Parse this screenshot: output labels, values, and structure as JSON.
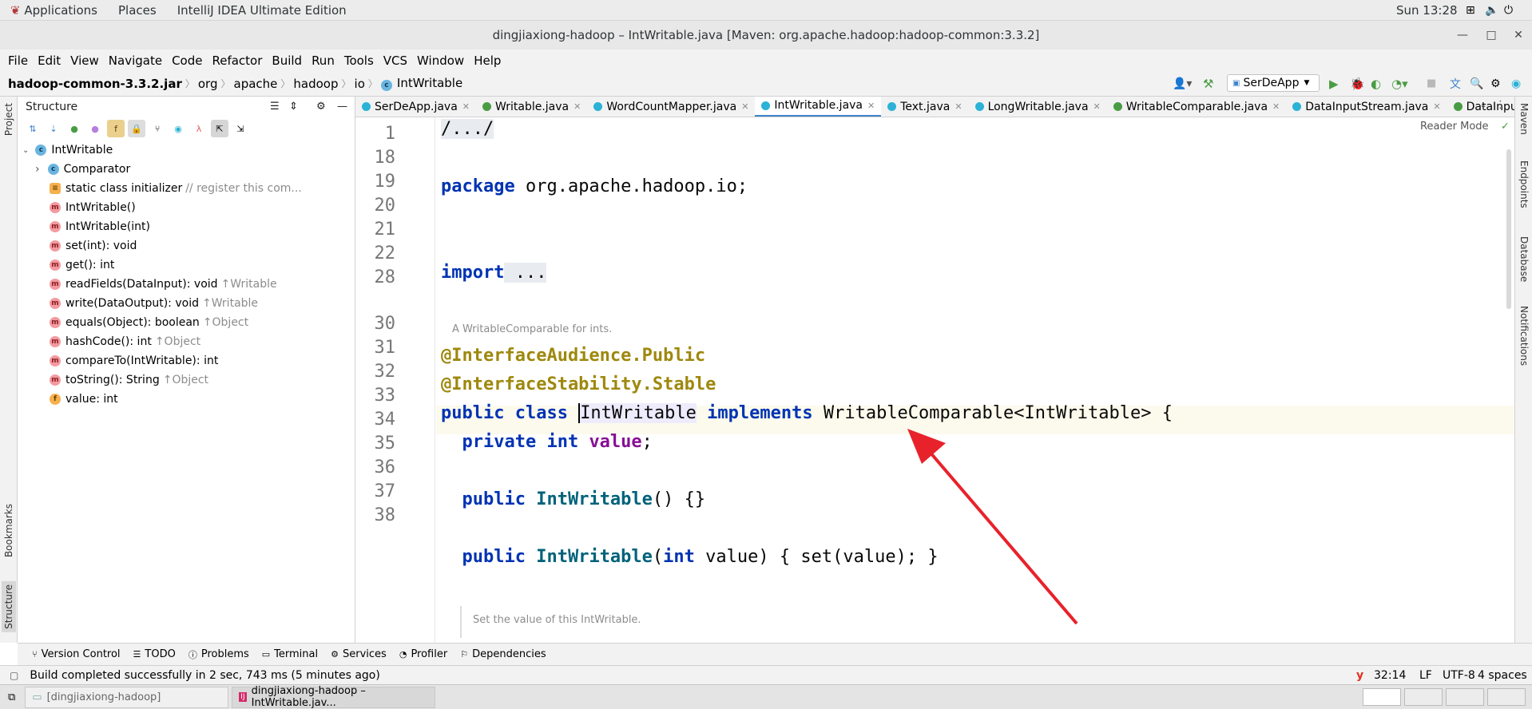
{
  "gnome": {
    "applications": "Applications",
    "places": "Places",
    "app": "IntelliJ IDEA Ultimate Edition",
    "clock": "Sun 13:28"
  },
  "window": {
    "title": "dingjiaxiong-hadoop – IntWritable.java [Maven: org.apache.hadoop:hadoop-common:3.3.2]"
  },
  "menu": [
    "File",
    "Edit",
    "View",
    "Navigate",
    "Code",
    "Refactor",
    "Build",
    "Run",
    "Tools",
    "VCS",
    "Window",
    "Help"
  ],
  "breadcrumb": [
    "hadoop-common-3.3.2.jar",
    "org",
    "apache",
    "hadoop",
    "io",
    "IntWritable"
  ],
  "run_config": "SerDeApp",
  "left_strip": {
    "project": "Project",
    "bookmarks": "Bookmarks",
    "structure": "Structure"
  },
  "right_strip": {
    "maven": "Maven",
    "endpoints": "Endpoints",
    "database": "Database",
    "notifications": "Notifications"
  },
  "structure": {
    "title": "Structure",
    "root": "IntWritable",
    "items": [
      {
        "icon": "c",
        "label": "Comparator",
        "hint": ""
      },
      {
        "icon": "s",
        "label": "static class initializer",
        "hint": "// register this com..."
      },
      {
        "icon": "m",
        "label": "IntWritable()",
        "hint": ""
      },
      {
        "icon": "m",
        "label": "IntWritable(int)",
        "hint": ""
      },
      {
        "icon": "m",
        "label": "set(int): void",
        "hint": ""
      },
      {
        "icon": "m",
        "label": "get(): int",
        "hint": ""
      },
      {
        "icon": "m",
        "label": "readFields(DataInput): void",
        "hint": "↑Writable"
      },
      {
        "icon": "m",
        "label": "write(DataOutput): void",
        "hint": "↑Writable"
      },
      {
        "icon": "m",
        "label": "equals(Object): boolean",
        "hint": "↑Object"
      },
      {
        "icon": "m",
        "label": "hashCode(): int",
        "hint": "↑Object"
      },
      {
        "icon": "m",
        "label": "compareTo(IntWritable): int",
        "hint": ""
      },
      {
        "icon": "m",
        "label": "toString(): String",
        "hint": "↑Object"
      },
      {
        "icon": "f",
        "label": "value: int",
        "hint": ""
      }
    ]
  },
  "tabs": [
    {
      "label": "SerDeApp.java",
      "kind": "c",
      "active": false
    },
    {
      "label": "Writable.java",
      "kind": "i",
      "active": false
    },
    {
      "label": "WordCountMapper.java",
      "kind": "c",
      "active": false
    },
    {
      "label": "IntWritable.java",
      "kind": "c",
      "active": true
    },
    {
      "label": "Text.java",
      "kind": "c",
      "active": false
    },
    {
      "label": "LongWritable.java",
      "kind": "c",
      "active": false
    },
    {
      "label": "WritableComparable.java",
      "kind": "i",
      "active": false
    },
    {
      "label": "DataInputStream.java",
      "kind": "c",
      "active": false
    },
    {
      "label": "DataInput.ja",
      "kind": "i",
      "active": false
    }
  ],
  "editor": {
    "reader_mode": "Reader Mode",
    "line_numbers": [
      "1",
      "18",
      "19",
      "20",
      "21",
      "22",
      "28",
      "30",
      "31",
      "32",
      "33",
      "34",
      "35",
      "36",
      "37",
      "38"
    ],
    "doc1": "A WritableComparable for ints.",
    "doc2": "Set the value of this IntWritable.",
    "fold1": "/.../",
    "pkg_kw": "package",
    "pkg_name": " org.apache.hadoop.io;",
    "import_kw": "import",
    "import_dots": " ...",
    "ann1": "@InterfaceAudience",
    "ann1b": ".Public",
    "ann2": "@InterfaceStability",
    "ann2b": ".Stable",
    "l32a": "public class ",
    "l32b": "IntWritable",
    "l32c": " implements ",
    "l32d": "WritableComparable<IntWritable> {",
    "l33a": "  private int ",
    "l33b": "value",
    ";": ";",
    "l35a": "  public ",
    "l35b": "IntWritable",
    "l35c": "() {}",
    "l37a": "  public ",
    "l37b": "IntWritable",
    "l37c": "(",
    "l37d": "int",
    " l37e": "",
    "l37f": " value) { set(value); }"
  },
  "bottom_tools": [
    "Version Control",
    "TODO",
    "Problems",
    "Terminal",
    "Services",
    "Profiler",
    "Dependencies"
  ],
  "status": {
    "message": "Build completed successfully in 2 sec, 743 ms (5 minutes ago)",
    "position": "32:14",
    "line_sep": "LF",
    "encoding": "UTF-8",
    "indent": "4 spaces"
  },
  "taskbar": [
    {
      "label": "[dingjiaxiong-hadoop]"
    },
    {
      "label": "dingjiaxiong-hadoop – IntWritable.jav..."
    }
  ],
  "colors": {
    "arrow": "#e8222b",
    "accent": "#4083c9"
  }
}
